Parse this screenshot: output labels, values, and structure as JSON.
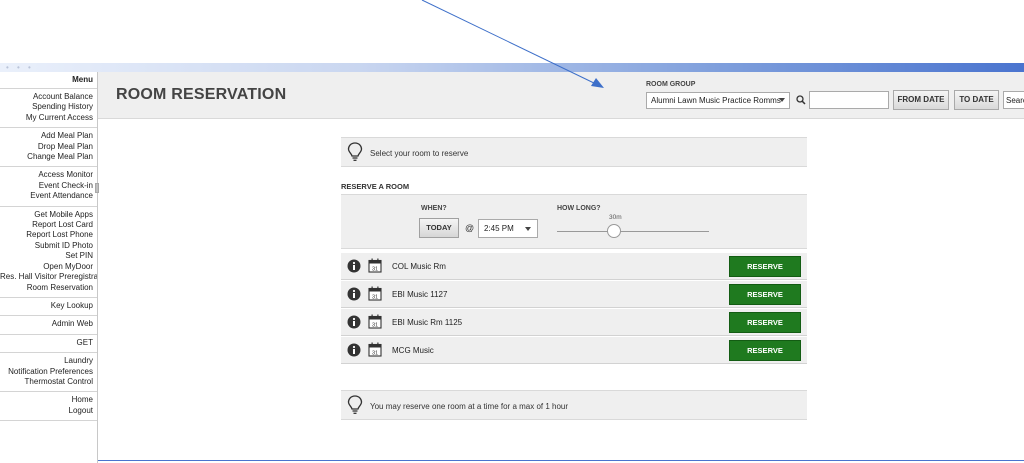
{
  "sidebar": {
    "menu_title": "Menu",
    "groups": [
      [
        "Account Balance",
        "Spending History",
        "My Current Access"
      ],
      [
        "Add Meal Plan",
        "Drop Meal Plan",
        "Change Meal Plan"
      ],
      [
        "Access Monitor",
        "Event Check-in",
        "Event Attendance"
      ],
      [
        "Get Mobile Apps",
        "Report Lost Card",
        "Report Lost Phone",
        "Submit ID Photo",
        "Set PIN",
        "Open MyDoor",
        "Res. Hall Visitor Preregistration",
        "Room Reservation"
      ],
      [
        "Key Lookup"
      ],
      [
        "Admin Web"
      ],
      [
        "GET"
      ],
      [
        "Laundry",
        "Notification Preferences",
        "Thermostat Control"
      ],
      [
        "Home",
        "Logout"
      ]
    ]
  },
  "header": {
    "title": "ROOM RESERVATION",
    "room_group_label": "ROOM GROUP",
    "room_group_value": "Alumni Lawn Music Practice Romms",
    "from_date_label": "FROM DATE",
    "to_date_label": "TO DATE",
    "search_value": "Search"
  },
  "content": {
    "tip_top": "Select your room to reserve",
    "section_title": "RESERVE A ROOM",
    "when_label": "WHEN?",
    "today_label": "TODAY",
    "at_sign": "@",
    "time_value": "2:45 PM",
    "how_long_label": "HOW LONG?",
    "duration_value": "30m",
    "rooms": [
      {
        "name": "COL Music Rm",
        "button": "RESERVE"
      },
      {
        "name": "EBI Music 1127",
        "button": "RESERVE"
      },
      {
        "name": "EBI Music Rm 1125",
        "button": "RESERVE"
      },
      {
        "name": "MCG Music",
        "button": "RESERVE"
      }
    ],
    "calendar_day": "31",
    "tip_bottom": "You may reserve one room at a time for a max of 1 hour"
  },
  "colors": {
    "reserve_green": "#1f7a1f",
    "accent_blue": "#4a74cf"
  }
}
